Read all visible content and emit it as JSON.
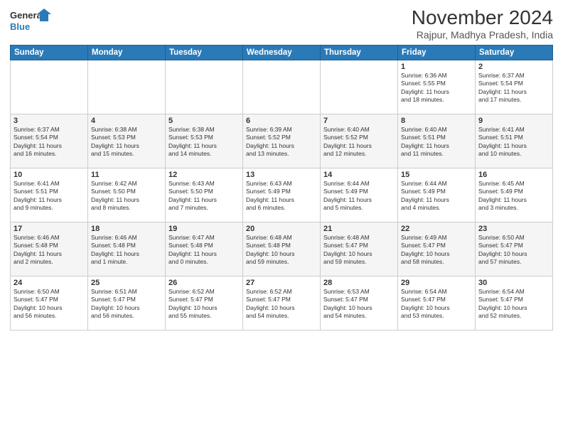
{
  "logo": {
    "line1": "General",
    "line2": "Blue"
  },
  "title": "November 2024",
  "subtitle": "Rajpur, Madhya Pradesh, India",
  "weekdays": [
    "Sunday",
    "Monday",
    "Tuesday",
    "Wednesday",
    "Thursday",
    "Friday",
    "Saturday"
  ],
  "weeks": [
    [
      {
        "day": "",
        "info": ""
      },
      {
        "day": "",
        "info": ""
      },
      {
        "day": "",
        "info": ""
      },
      {
        "day": "",
        "info": ""
      },
      {
        "day": "",
        "info": ""
      },
      {
        "day": "1",
        "info": "Sunrise: 6:36 AM\nSunset: 5:55 PM\nDaylight: 11 hours\nand 18 minutes."
      },
      {
        "day": "2",
        "info": "Sunrise: 6:37 AM\nSunset: 5:54 PM\nDaylight: 11 hours\nand 17 minutes."
      }
    ],
    [
      {
        "day": "3",
        "info": "Sunrise: 6:37 AM\nSunset: 5:54 PM\nDaylight: 11 hours\nand 16 minutes."
      },
      {
        "day": "4",
        "info": "Sunrise: 6:38 AM\nSunset: 5:53 PM\nDaylight: 11 hours\nand 15 minutes."
      },
      {
        "day": "5",
        "info": "Sunrise: 6:38 AM\nSunset: 5:53 PM\nDaylight: 11 hours\nand 14 minutes."
      },
      {
        "day": "6",
        "info": "Sunrise: 6:39 AM\nSunset: 5:52 PM\nDaylight: 11 hours\nand 13 minutes."
      },
      {
        "day": "7",
        "info": "Sunrise: 6:40 AM\nSunset: 5:52 PM\nDaylight: 11 hours\nand 12 minutes."
      },
      {
        "day": "8",
        "info": "Sunrise: 6:40 AM\nSunset: 5:51 PM\nDaylight: 11 hours\nand 11 minutes."
      },
      {
        "day": "9",
        "info": "Sunrise: 6:41 AM\nSunset: 5:51 PM\nDaylight: 11 hours\nand 10 minutes."
      }
    ],
    [
      {
        "day": "10",
        "info": "Sunrise: 6:41 AM\nSunset: 5:51 PM\nDaylight: 11 hours\nand 9 minutes."
      },
      {
        "day": "11",
        "info": "Sunrise: 6:42 AM\nSunset: 5:50 PM\nDaylight: 11 hours\nand 8 minutes."
      },
      {
        "day": "12",
        "info": "Sunrise: 6:43 AM\nSunset: 5:50 PM\nDaylight: 11 hours\nand 7 minutes."
      },
      {
        "day": "13",
        "info": "Sunrise: 6:43 AM\nSunset: 5:49 PM\nDaylight: 11 hours\nand 6 minutes."
      },
      {
        "day": "14",
        "info": "Sunrise: 6:44 AM\nSunset: 5:49 PM\nDaylight: 11 hours\nand 5 minutes."
      },
      {
        "day": "15",
        "info": "Sunrise: 6:44 AM\nSunset: 5:49 PM\nDaylight: 11 hours\nand 4 minutes."
      },
      {
        "day": "16",
        "info": "Sunrise: 6:45 AM\nSunset: 5:49 PM\nDaylight: 11 hours\nand 3 minutes."
      }
    ],
    [
      {
        "day": "17",
        "info": "Sunrise: 6:46 AM\nSunset: 5:48 PM\nDaylight: 11 hours\nand 2 minutes."
      },
      {
        "day": "18",
        "info": "Sunrise: 6:46 AM\nSunset: 5:48 PM\nDaylight: 11 hours\nand 1 minute."
      },
      {
        "day": "19",
        "info": "Sunrise: 6:47 AM\nSunset: 5:48 PM\nDaylight: 11 hours\nand 0 minutes."
      },
      {
        "day": "20",
        "info": "Sunrise: 6:48 AM\nSunset: 5:48 PM\nDaylight: 10 hours\nand 59 minutes."
      },
      {
        "day": "21",
        "info": "Sunrise: 6:48 AM\nSunset: 5:47 PM\nDaylight: 10 hours\nand 59 minutes."
      },
      {
        "day": "22",
        "info": "Sunrise: 6:49 AM\nSunset: 5:47 PM\nDaylight: 10 hours\nand 58 minutes."
      },
      {
        "day": "23",
        "info": "Sunrise: 6:50 AM\nSunset: 5:47 PM\nDaylight: 10 hours\nand 57 minutes."
      }
    ],
    [
      {
        "day": "24",
        "info": "Sunrise: 6:50 AM\nSunset: 5:47 PM\nDaylight: 10 hours\nand 56 minutes."
      },
      {
        "day": "25",
        "info": "Sunrise: 6:51 AM\nSunset: 5:47 PM\nDaylight: 10 hours\nand 56 minutes."
      },
      {
        "day": "26",
        "info": "Sunrise: 6:52 AM\nSunset: 5:47 PM\nDaylight: 10 hours\nand 55 minutes."
      },
      {
        "day": "27",
        "info": "Sunrise: 6:52 AM\nSunset: 5:47 PM\nDaylight: 10 hours\nand 54 minutes."
      },
      {
        "day": "28",
        "info": "Sunrise: 6:53 AM\nSunset: 5:47 PM\nDaylight: 10 hours\nand 54 minutes."
      },
      {
        "day": "29",
        "info": "Sunrise: 6:54 AM\nSunset: 5:47 PM\nDaylight: 10 hours\nand 53 minutes."
      },
      {
        "day": "30",
        "info": "Sunrise: 6:54 AM\nSunset: 5:47 PM\nDaylight: 10 hours\nand 52 minutes."
      }
    ]
  ]
}
